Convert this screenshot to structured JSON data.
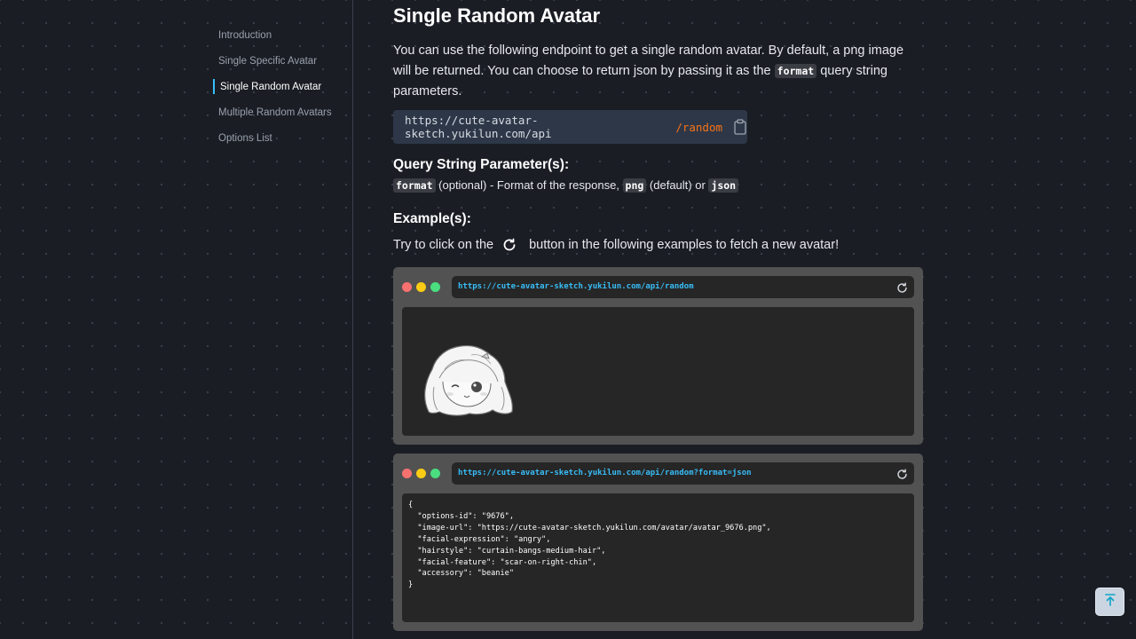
{
  "sidebar": {
    "items": [
      {
        "label": "Introduction"
      },
      {
        "label": "Single Specific Avatar"
      },
      {
        "label": "Single Random Avatar",
        "active": true
      },
      {
        "label": "Multiple Random Avatars"
      },
      {
        "label": "Options List"
      }
    ]
  },
  "main": {
    "title": "Single Random Avatar",
    "intro": {
      "part1": "You can use the following endpoint to get a single random avatar. By default, a png image will be returned. You can choose to return json by passing it as the ",
      "code": "format",
      "part2": " query string parameters."
    },
    "endpoint": {
      "base": "https://cute-avatar-sketch.yukilun.com/api",
      "path": "/random",
      "copy_icon": "clipboard-icon"
    },
    "query_params": {
      "heading": "Query String Parameter(s):",
      "param": "format",
      "text1": " (optional) - Format of the response, ",
      "opt1": "png",
      "text2": " (default) or ",
      "opt2": "json"
    },
    "examples": {
      "heading": "Example(s):",
      "hint_before": "Try to click on the",
      "hint_after": "button in the following examples to fetch a new avatar!",
      "reload_icon": "reload-icon"
    },
    "browser1": {
      "url": "https://cute-avatar-sketch.yukilun.com/api/random"
    },
    "browser2": {
      "url": "https://cute-avatar-sketch.yukilun.com/api/random?format=json",
      "json": "{\n  \"options-id\": \"9676\",\n  \"image-url\": \"https://cute-avatar-sketch.yukilun.com/avatar/avatar_9676.png\",\n  \"facial-expression\": \"angry\",\n  \"hairstyle\": \"curtain-bangs-medium-hair\",\n  \"facial-feature\": \"scar-on-right-chin\",\n  \"accessory\": \"beanie\"\n}"
    }
  },
  "colors": {
    "background": "#1a1d24",
    "accent_sidebar": "#38bdf8",
    "endpoint_accent": "#f97316",
    "url_text": "#38bdf8",
    "dot_red": "#f87171",
    "dot_yellow": "#facc15",
    "dot_green": "#4ade80"
  },
  "back_to_top": {
    "icon": "arrow-to-top-icon"
  }
}
